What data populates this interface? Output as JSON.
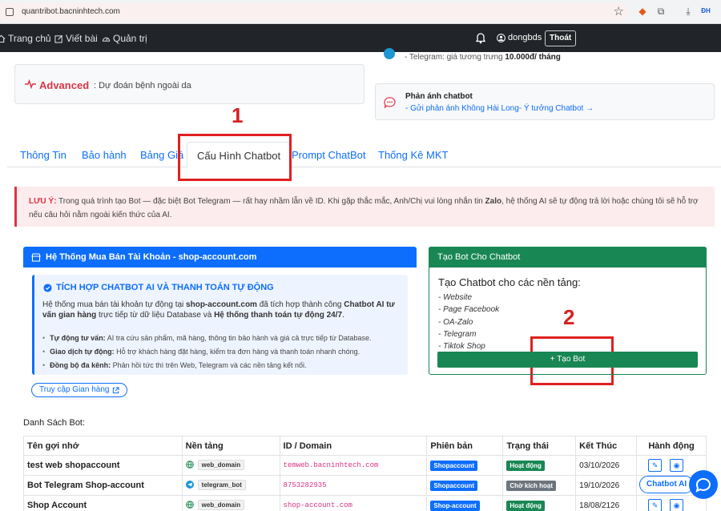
{
  "browser": {
    "url": "quantribot.bacninhtech.com"
  },
  "nav": {
    "home": "Trang chủ",
    "post": "Viết bài",
    "admin": "Quản trị",
    "user": "dongbds",
    "logout": "Thoát"
  },
  "top": {
    "advanced_title": "Advanced",
    "advanced_sub": ": Dự đoán bệnh ngoài da",
    "telegram_prefix": "- Telegram: giá tương trưng ",
    "telegram_price": "10.000đ/ tháng",
    "feedback_title": "Phản ánh chatbot",
    "feedback_link": "- Gửi phản ánh Không Hài Long- Ý tưởng Chatbot →"
  },
  "tabs": [
    {
      "label": "Thông Tin"
    },
    {
      "label": "Bảo hành"
    },
    {
      "label": "Bảng Giá"
    },
    {
      "label": "Cấu Hình Chatbot"
    },
    {
      "label": "Prompt ChatBot"
    },
    {
      "label": "Thống Kê MKT"
    }
  ],
  "markers": {
    "one": "1",
    "two": "2"
  },
  "alert": {
    "label": "LƯU Ý:",
    "text_1": " Trong quá trình tạo Bot — đặc biệt Bot Telegram — rất hay nhầm lẫn về ID. Khi gặp thắc mắc, Anh/Chị vui lòng nhắn tin ",
    "zalo": "Zalo",
    "text_2": ", hệ thống AI sẽ tự động trả lời hoặc chúng tôi sẽ hỗ trợ nếu câu hỏi nằm ngoài kiến thức của AI."
  },
  "left_card": {
    "header": "Hệ Thống Mua Bán Tài Khoản - shop-account.com",
    "box_title": "TÍCH HỢP CHATBOT AI VÀ THANH TOÁN TỰ ĐỘNG",
    "desc_1": "Hệ thống mua bán tài khoản tự động tại ",
    "desc_site": "shop-account.com",
    "desc_2": " đã tích hợp thành công ",
    "desc_chatbot": "Chatbot AI tư vấn gian hàng",
    "desc_3": " trực tiếp từ dữ liệu Database và ",
    "desc_pay": "Hệ thống thanh toán tự động 24/7",
    "desc_4": ".",
    "items": [
      {
        "bold": "Tự động tư vấn:",
        "text": " AI tra cứu sản phẩm, mã hàng, thông tin bảo hành và giá cả trực tiếp từ Database."
      },
      {
        "bold": "Giao dịch tự động:",
        "text": " Hỗ trợ khách hàng đặt hàng, kiểm tra đơn hàng và thanh toán nhanh chóng."
      },
      {
        "bold": "Đồng bộ đa kênh:",
        "text": " Phản hồi tức thì trên Web, Telegram và các nền tảng kết nối."
      }
    ],
    "visit_button": "Truy cập Gian hàng"
  },
  "right_card": {
    "header": "Tạo Bot Cho Chatbot",
    "title": "Tạo Chatbot cho các nền tảng:",
    "platforms": [
      "- Website",
      "- Page Facebook",
      "- OA-Zalo",
      "- Telegram",
      "- Tiktok Shop"
    ],
    "create_button": "+ Tạo Bot"
  },
  "bots": {
    "title": "Danh Sách Bot:",
    "columns": [
      "Tên gợi nhớ",
      "Nền tảng",
      "ID / Domain",
      "Phiên bản",
      "Trạng thái",
      "Kết Thúc",
      "Hành động"
    ],
    "rows": [
      {
        "name": "test web shopaccount",
        "platform": "web_domain",
        "id": "temweb.bacninhtech.com",
        "version": "Shopaccount",
        "status": "Hoạt động",
        "end": "03/10/2026"
      },
      {
        "name": "Bot Telegram Shop-account",
        "platform": "telegram_bot",
        "id": "8753282935",
        "version": "Shopaccount",
        "status": "Chờ kích hoạt",
        "end": "19/10/2026"
      },
      {
        "name": "Shop Account",
        "platform": "web_domain",
        "id": "shop-account.com",
        "version": "Shop-account",
        "status": "Hoạt động",
        "end": "18/08/2126"
      }
    ]
  },
  "chat_widget": {
    "label": "Chatbot AI"
  },
  "colors": {
    "primary": "#0d6efd",
    "success": "#198754",
    "danger": "#dc3545",
    "secondary": "#6c757d",
    "navbar": "#212529",
    "annotation": "#e02020"
  }
}
